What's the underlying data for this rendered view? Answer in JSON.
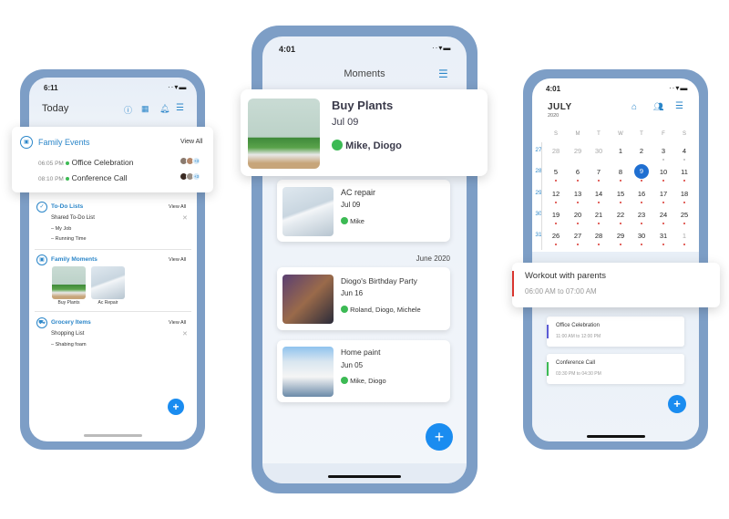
{
  "left_phone": {
    "status_time": "6:11",
    "title": "Today",
    "header_icons": [
      "help-icon",
      "calendar-icon",
      "bell-icon",
      "filter-icon"
    ],
    "family_events": {
      "title": "Family Events",
      "view_all": "View All",
      "items": [
        {
          "time": "06:05 PM",
          "name": "Office Celebration",
          "extra": "+3"
        },
        {
          "time": "08:10 PM",
          "name": "Conference Call",
          "extra": "+3"
        }
      ]
    },
    "todo": {
      "title": "To-Do Lists",
      "view_all": "View All",
      "list_name": "Shared To-Do List",
      "items": [
        "My Job",
        "Running Time"
      ]
    },
    "moments": {
      "title": "Family Moments",
      "view_all": "View All",
      "items": [
        "Buy Plants",
        "Ac Repair"
      ]
    },
    "grocery": {
      "title": "Grocery Items",
      "view_all": "View All",
      "list_name": "Shopping List",
      "items": [
        "Shabing foam"
      ]
    },
    "fab": "+"
  },
  "middle_phone": {
    "status_time": "4:01",
    "title": "Moments",
    "featured": {
      "title": "Buy Plants",
      "date": "Jul 09",
      "people": "Mike, Diogo"
    },
    "items": [
      {
        "title": "AC repair",
        "date": "Jul 09",
        "people": "Mike"
      },
      {
        "title": "Diogo's Birthday Party",
        "date": "Jun 16",
        "people": "Roland, Diogo, Michele"
      },
      {
        "title": "Home paint",
        "date": "Jun 05",
        "people": "Mike, Diogo"
      }
    ],
    "section_label": "June 2020",
    "fab": "+"
  },
  "right_phone": {
    "status_time": "4:01",
    "month": "JULY",
    "year": "2020",
    "weekday_headers": [
      "S",
      "M",
      "T",
      "W",
      "T",
      "F",
      "S"
    ],
    "weeks": [
      {
        "num": "27",
        "days": [
          "28",
          "29",
          "30",
          "1",
          "2",
          "3",
          "4"
        ]
      },
      {
        "num": "28",
        "days": [
          "5",
          "6",
          "7",
          "8",
          "9",
          "10",
          "11"
        ]
      },
      {
        "num": "29",
        "days": [
          "12",
          "13",
          "14",
          "15",
          "16",
          "17",
          "18"
        ]
      },
      {
        "num": "30",
        "days": [
          "19",
          "20",
          "21",
          "22",
          "23",
          "24",
          "25"
        ]
      },
      {
        "num": "31",
        "days": [
          "26",
          "27",
          "28",
          "29",
          "30",
          "31",
          "1"
        ]
      }
    ],
    "selected_day": "9",
    "featured_event": {
      "title": "Workout with parents",
      "time": "06:00 AM to 07:00 AM",
      "color": "#d9352f"
    },
    "events": [
      {
        "title": "Office Celebration",
        "time": "11:00 AM to 12:00 PM",
        "color": "#5b5bd6"
      },
      {
        "title": "Conference Call",
        "time": "03:30 PM to 04:30 PM",
        "color": "#3cba54"
      }
    ],
    "fab": "+"
  },
  "colors": {
    "accent": "#2b86c9",
    "fab": "#1a8cf0",
    "frame": "#7d9ec6",
    "green": "#3cba54",
    "selected": "#1f6fd1"
  }
}
